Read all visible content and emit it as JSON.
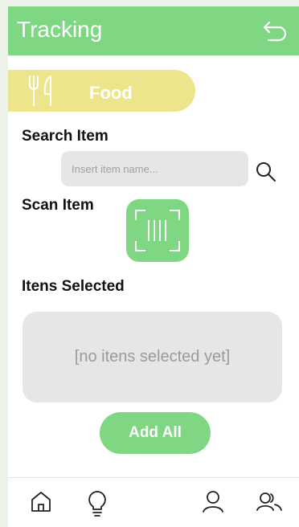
{
  "header": {
    "title": "Tracking",
    "back_icon": "return-arrow-icon",
    "background": "#7fd784"
  },
  "category": {
    "label": "Food",
    "icon": "fork-knife-icon",
    "background": "#ede58b"
  },
  "search": {
    "section_label": "Search Item",
    "placeholder": "Insert item name...",
    "value": "",
    "icon": "search-icon"
  },
  "scan": {
    "section_label": "Scan Item",
    "icon": "barcode-scan-icon"
  },
  "selected": {
    "section_label": "Itens Selected",
    "empty_text": "[no itens selected yet]"
  },
  "actions": {
    "add_all_label": "Add All"
  },
  "bottom_nav": {
    "items": [
      {
        "icon": "home-icon"
      },
      {
        "icon": "lightbulb-icon"
      },
      {
        "icon": "user-icon"
      },
      {
        "icon": "users-icon"
      }
    ]
  },
  "colors": {
    "accent_green": "#7fd784",
    "accent_yellow": "#ede58b",
    "input_gray": "#e6e6e6"
  }
}
